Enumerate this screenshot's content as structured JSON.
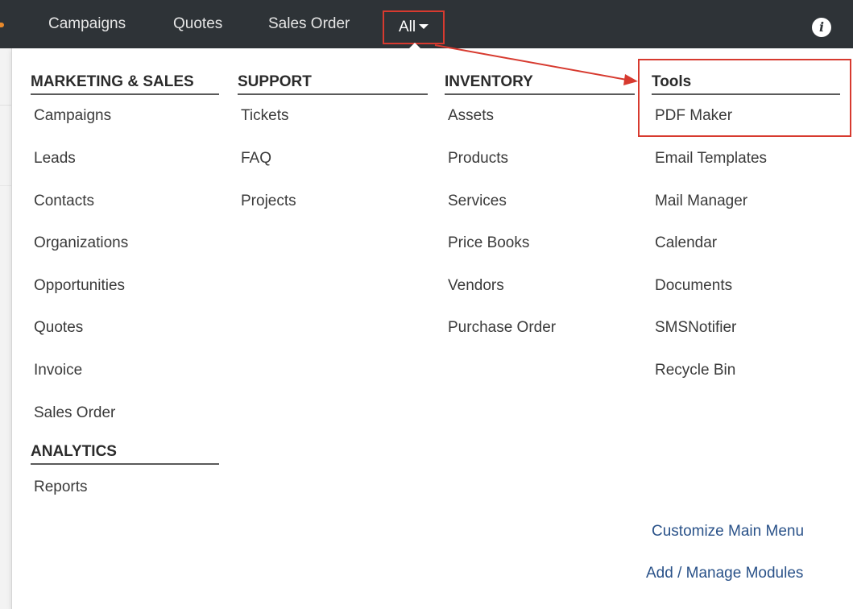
{
  "navbar": {
    "items": [
      {
        "label": "Campaigns"
      },
      {
        "label": "Quotes"
      },
      {
        "label": "Sales Order"
      }
    ],
    "all_label": "All",
    "info_glyph": "i"
  },
  "menu": {
    "columns": [
      {
        "header": "MARKETING & SALES",
        "items": [
          "Campaigns",
          "Leads",
          "Contacts",
          "Organizations",
          "Opportunities",
          "Quotes",
          "Invoice",
          "Sales Order"
        ]
      },
      {
        "header": "SUPPORT",
        "items": [
          "Tickets",
          "FAQ",
          "Projects"
        ]
      },
      {
        "header": "INVENTORY",
        "items": [
          "Assets",
          "Products",
          "Services",
          "Price Books",
          "Vendors",
          "Purchase Order"
        ]
      },
      {
        "header": "Tools",
        "items": [
          "PDF Maker",
          "Email Templates",
          "Mail Manager",
          "Calendar",
          "Documents",
          "SMSNotifier",
          "Recycle Bin"
        ]
      }
    ],
    "analytics": {
      "header": "ANALYTICS",
      "items": [
        "Reports"
      ]
    },
    "footer_links": [
      "Customize Main Menu",
      "Add / Manage Modules"
    ]
  },
  "colors": {
    "navbar_bg": "#2e3337",
    "annotation_red": "#d73a2f",
    "link_blue": "#2a5289"
  }
}
